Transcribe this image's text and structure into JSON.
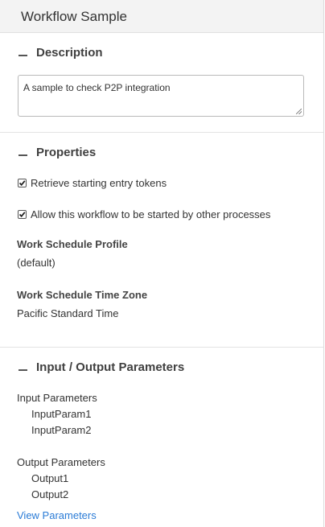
{
  "header": {
    "title": "Workflow Sample"
  },
  "description": {
    "heading": "Description",
    "value": "A sample to check P2P integration"
  },
  "properties": {
    "heading": "Properties",
    "checkboxes": [
      {
        "label": "Retrieve starting entry tokens",
        "checked": true
      },
      {
        "label": "Allow this workflow to be started by other processes",
        "checked": true
      }
    ],
    "work_schedule_profile": {
      "label": "Work Schedule Profile",
      "value": "(default)"
    },
    "work_schedule_time_zone": {
      "label": "Work Schedule Time Zone",
      "value": "Pacific Standard Time"
    }
  },
  "io_parameters": {
    "heading": "Input / Output Parameters",
    "input": {
      "label": "Input Parameters",
      "items": [
        "InputParam1",
        "InputParam2"
      ]
    },
    "output": {
      "label": "Output Parameters",
      "items": [
        "Output1",
        "Output2"
      ]
    },
    "view_link": "View Parameters"
  },
  "colors": {
    "link": "#2a7bd6",
    "header_bg": "#f3f3f3"
  },
  "icons": {
    "collapse": "minus-icon",
    "checkbox_mark": "checkmark-icon"
  }
}
